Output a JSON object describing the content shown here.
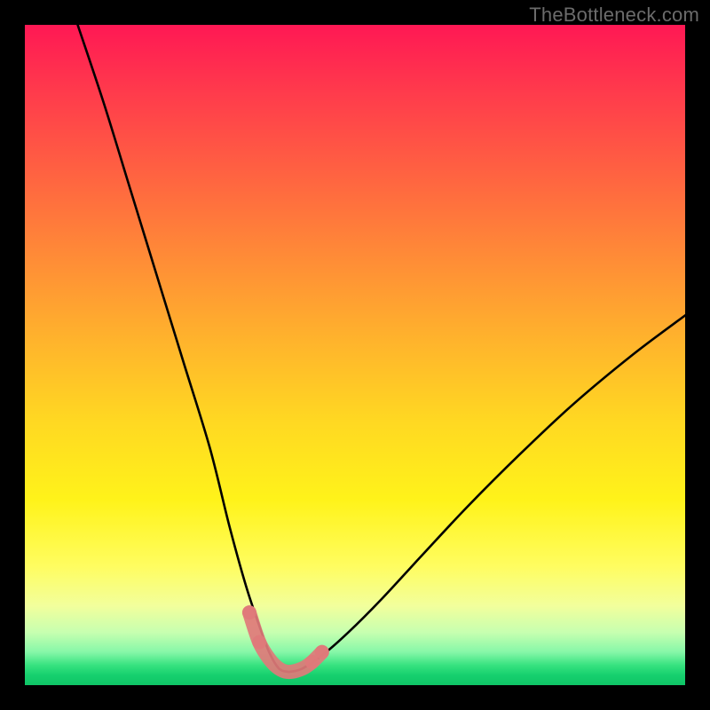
{
  "watermark": "TheBottleneck.com",
  "chart_data": {
    "type": "line",
    "title": "",
    "xlabel": "",
    "ylabel": "",
    "xlim": [
      0,
      100
    ],
    "ylim": [
      0,
      100
    ],
    "description": "Bottleneck curve: two descending arcs meeting in a valley near x≈40 over a red→yellow→green vertical gradient; a pink highlight segment marks the valley floor.",
    "series": [
      {
        "name": "left-arc",
        "x": [
          8,
          12,
          16,
          20,
          24,
          28,
          31,
          33.5,
          35.5,
          37,
          38.5,
          40
        ],
        "values": [
          100,
          88,
          75,
          62,
          49,
          36,
          24,
          15,
          9,
          5,
          2.5,
          2
        ]
      },
      {
        "name": "right-arc",
        "x": [
          40,
          42,
          45,
          49,
          54,
          60,
          67,
          75,
          83,
          92,
          100
        ],
        "values": [
          2,
          2.5,
          4.5,
          8,
          13,
          19.5,
          27,
          35,
          42.5,
          50,
          56
        ]
      },
      {
        "name": "valley-marker",
        "x": [
          34,
          35.5,
          37,
          38.5,
          40,
          42,
          43.5,
          45
        ],
        "values": [
          11,
          6.5,
          4,
          2.5,
          2,
          2.5,
          3.5,
          5
        ]
      }
    ],
    "marker_color": "#e07a7a",
    "gradient_stops": [
      {
        "pct": 0,
        "color": "#ff1854"
      },
      {
        "pct": 60,
        "color": "#ffd822"
      },
      {
        "pct": 88,
        "color": "#f2ff9c"
      },
      {
        "pct": 100,
        "color": "#0fc466"
      }
    ]
  }
}
